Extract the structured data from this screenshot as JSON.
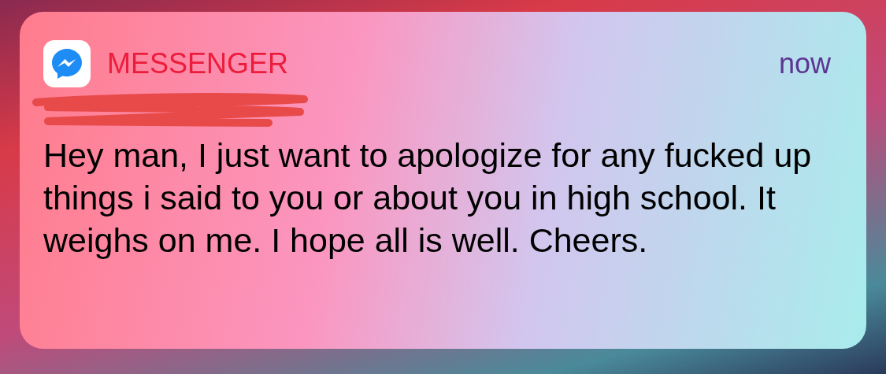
{
  "notification": {
    "app_name": "MESSENGER",
    "time": "now",
    "sender_redacted": true,
    "message": "Hey man, I just want to apologize for any fucked up things i said to you or about you in high school. It weighs on me. I hope all is well. Cheers."
  }
}
